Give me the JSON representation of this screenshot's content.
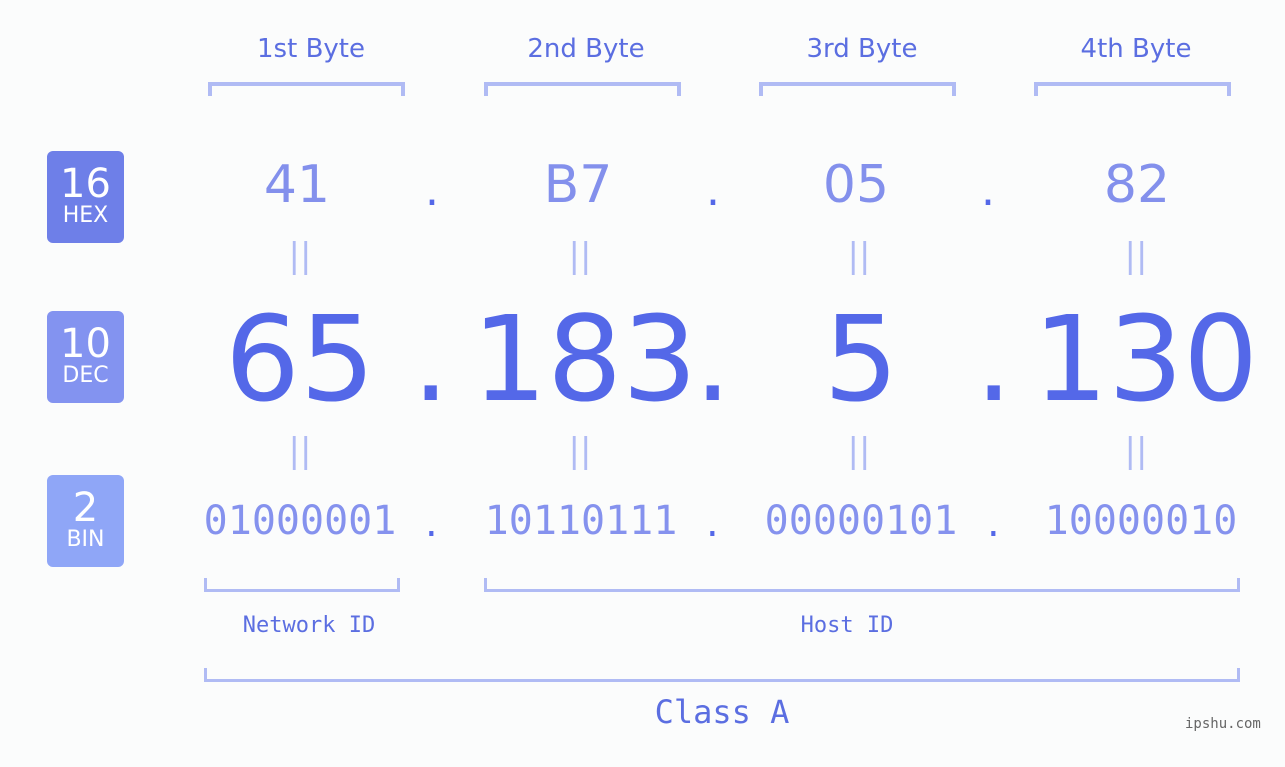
{
  "bytes": [
    {
      "label": "1st Byte",
      "hex": "41",
      "dec": "65",
      "bin": "01000001"
    },
    {
      "label": "2nd Byte",
      "hex": "B7",
      "dec": "183",
      "bin": "10110111"
    },
    {
      "label": "3rd Byte",
      "hex": "05",
      "dec": "5",
      "bin": "00000101"
    },
    {
      "label": "4th Byte",
      "hex": "82",
      "dec": "130",
      "bin": "10000010"
    }
  ],
  "badges": {
    "hex": {
      "num": "16",
      "label": "HEX",
      "color": "#6e7fe8"
    },
    "dec": {
      "num": "10",
      "label": "DEC",
      "color": "#8393f0"
    },
    "bin": {
      "num": "2",
      "label": "BIN",
      "color": "#8fa6f7"
    }
  },
  "separator": ".",
  "equals": "=",
  "network_id": "Network ID",
  "host_id": "Host ID",
  "class_label": "Class A",
  "watermark": "ipshu.com"
}
